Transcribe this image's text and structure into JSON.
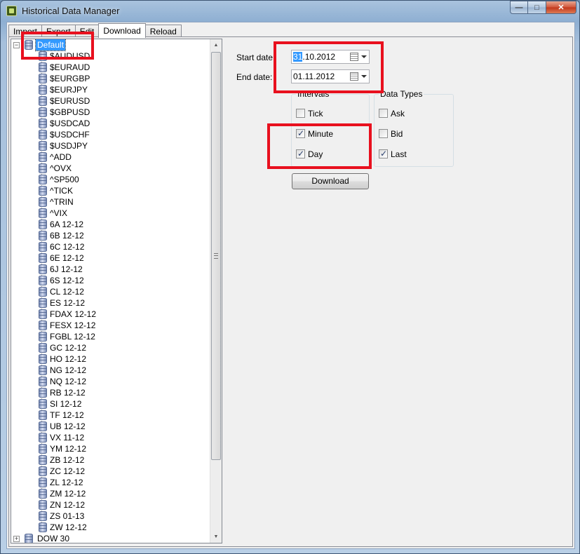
{
  "window": {
    "title": "Historical Data Manager",
    "caption_minimize": "—",
    "caption_maximize": "□",
    "caption_close": "✕"
  },
  "tabs": [
    {
      "label": "Import",
      "active": false
    },
    {
      "label": "Export",
      "active": false
    },
    {
      "label": "Edit",
      "active": false
    },
    {
      "label": "Download",
      "active": true
    },
    {
      "label": "Reload",
      "active": false
    }
  ],
  "tree": {
    "root": {
      "label": "Default",
      "expander": "−",
      "selected": true
    },
    "children": [
      "$AUDUSD",
      "$EURAUD",
      "$EURGBP",
      "$EURJPY",
      "$EURUSD",
      "$GBPUSD",
      "$USDCAD",
      "$USDCHF",
      "$USDJPY",
      "^ADD",
      "^OVX",
      "^SP500",
      "^TICK",
      "^TRIN",
      "^VIX",
      "6A 12-12",
      "6B 12-12",
      "6C 12-12",
      "6E 12-12",
      "6J 12-12",
      "6S 12-12",
      "CL 12-12",
      "ES 12-12",
      "FDAX 12-12",
      "FESX 12-12",
      "FGBL 12-12",
      "GC 12-12",
      "HO 12-12",
      "NG 12-12",
      "NQ 12-12",
      "RB 12-12",
      "SI 12-12",
      "TF 12-12",
      "UB 12-12",
      "VX 11-12",
      "YM 12-12",
      "ZB 12-12",
      "ZC 12-12",
      "ZL 12-12",
      "ZM 12-12",
      "ZN 12-12",
      "ZS 01-13",
      "ZW 12-12"
    ],
    "second_root": {
      "label": "DOW 30",
      "expander": "+"
    }
  },
  "form": {
    "start_label": "Start date:",
    "start_value_highlight": "31",
    "start_value_rest": ".10.2012",
    "end_label": "End date:",
    "end_value": "01.11.2012",
    "intervals_title": "Intervals",
    "intervals": [
      {
        "label": "Tick",
        "checked": false
      },
      {
        "label": "Minute",
        "checked": true
      },
      {
        "label": "Day",
        "checked": true
      }
    ],
    "types_title": "Data Types",
    "types": [
      {
        "label": "Ask",
        "checked": false
      },
      {
        "label": "Bid",
        "checked": false
      },
      {
        "label": "Last",
        "checked": true
      }
    ],
    "download_button": "Download"
  },
  "colors": {
    "annotation": "#e8101e",
    "selection": "#3399ff"
  }
}
